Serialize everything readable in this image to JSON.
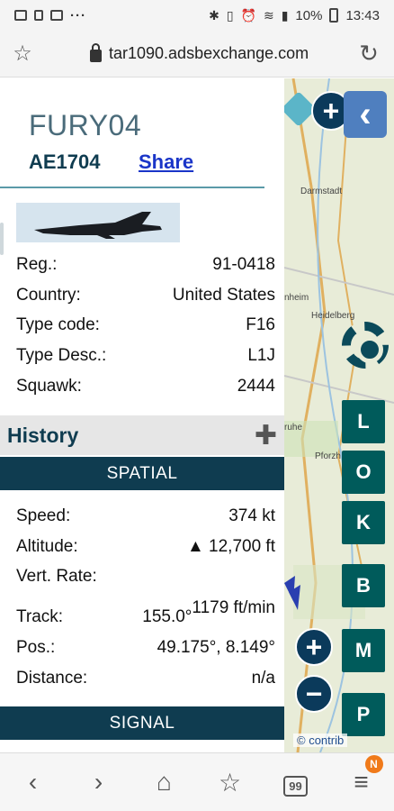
{
  "status_bar": {
    "dots": "···",
    "battery": "10%",
    "time": "13:43"
  },
  "browser": {
    "url": "tar1090.adsbexchange.com"
  },
  "aircraft": {
    "callsign": "FURY04",
    "hex": "AE1704",
    "share_label": "Share"
  },
  "details": [
    {
      "label": "Reg.:",
      "value": "91-0418"
    },
    {
      "label": "Country:",
      "value": "United States"
    },
    {
      "label": "Type code:",
      "value": "F16"
    },
    {
      "label": "Type Desc.:",
      "value": "L1J"
    },
    {
      "label": "Squawk:",
      "value": "2444"
    }
  ],
  "history": {
    "title": "History",
    "spatial_label": "SPATIAL",
    "signal_label": "SIGNAL"
  },
  "spatial": [
    {
      "label": "Speed:",
      "value": "374 kt"
    },
    {
      "label": "Altitude:",
      "value": "▲ 12,700 ft"
    },
    {
      "label": "Vert. Rate:",
      "value": ""
    },
    {
      "label": "Track:",
      "value": "155.0°",
      "extra": "1179 ft/min"
    },
    {
      "label": "Pos.:",
      "value": "49.175°, 8.149°"
    },
    {
      "label": "Distance:",
      "value": "n/a"
    }
  ],
  "map": {
    "labels": {
      "darmstadt": "Darmstadt",
      "mannheim": "nheim",
      "heidelberg": "Heidelberg",
      "karlsruhe": "ruhe",
      "pforzheim": "Pforzh",
      "attribution": "© contrib"
    },
    "buttons": [
      "L",
      "O",
      "K",
      "B",
      "M",
      "P"
    ],
    "colors": {
      "button_bg": "#005b5b",
      "back_bg": "#4f7fbf",
      "panel_bar": "#0f3c50"
    }
  },
  "bottom_nav": {
    "tabs_count": "99",
    "badge": "N"
  }
}
